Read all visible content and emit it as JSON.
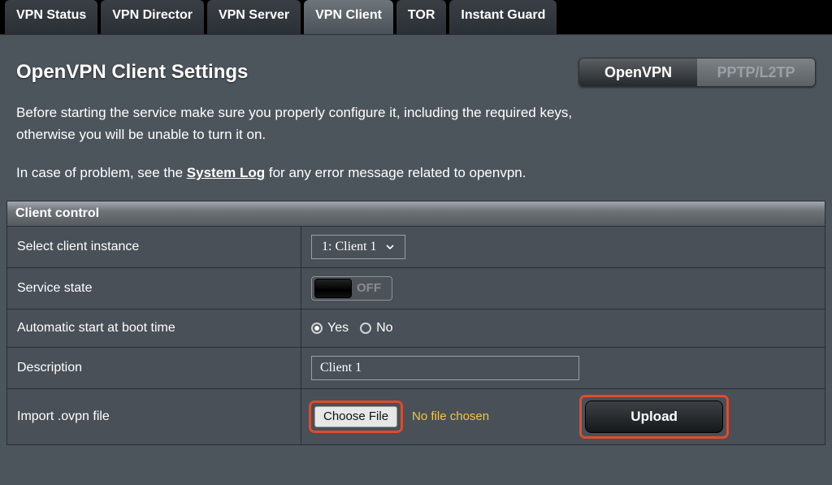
{
  "tabs": [
    {
      "label": "VPN Status"
    },
    {
      "label": "VPN Director"
    },
    {
      "label": "VPN Server"
    },
    {
      "label": "VPN Client",
      "active": true
    },
    {
      "label": "TOR"
    },
    {
      "label": "Instant Guard"
    }
  ],
  "section_title": "OpenVPN Client Settings",
  "protocol_segment": {
    "active": "OpenVPN",
    "inactive": "PPTP/L2TP"
  },
  "intro": {
    "p1_a": "Before starting the service make sure you properly configure it, including the required keys,",
    "p1_b": "otherwise you will be unable to turn it on.",
    "p2_a": "In case of problem, see the ",
    "p2_link": "System Log",
    "p2_b": " for any error message related to openvpn."
  },
  "table": {
    "header": "Client control",
    "rows": {
      "select_instance": {
        "label": "Select client instance",
        "value": "1: Client 1"
      },
      "service_state": {
        "label": "Service state",
        "value": "OFF"
      },
      "auto_start": {
        "label": "Automatic start at boot time",
        "yes": "Yes",
        "no": "No",
        "selected": "yes"
      },
      "description": {
        "label": "Description",
        "value": "Client 1"
      },
      "import": {
        "label": "Import .ovpn file",
        "choose_file": "Choose File",
        "file_status": "No file chosen",
        "upload": "Upload"
      }
    }
  }
}
